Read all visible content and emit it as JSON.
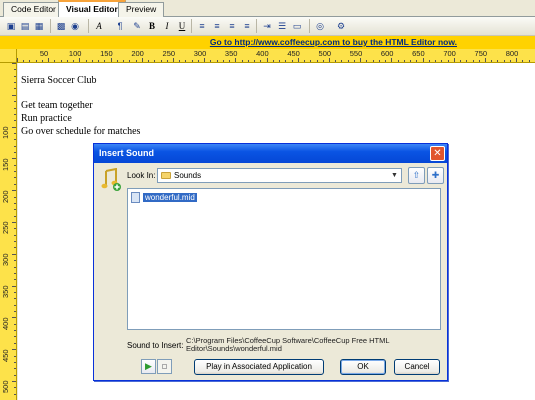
{
  "tabs": [
    {
      "label": "Code Editor"
    },
    {
      "label": "Visual Editor",
      "active": true
    },
    {
      "label": "Preview"
    }
  ],
  "toolbar": {
    "bold": "B",
    "italic": "I",
    "underline": "U",
    "paragraph": "¶",
    "font_color": "A"
  },
  "promo": {
    "text": "Go to http://www.coffeecup.com to buy the HTML Editor now."
  },
  "ruler": {
    "horizontal": [
      "50",
      "100",
      "150",
      "200",
      "250",
      "300",
      "350",
      "400",
      "450",
      "500",
      "550",
      "600",
      "650",
      "700",
      "750",
      "800"
    ],
    "vertical": [
      "100",
      "150",
      "200",
      "250",
      "300",
      "350",
      "400",
      "450",
      "500"
    ]
  },
  "document": {
    "lines": [
      "Sierra Soccer Club",
      "Get team together",
      "Run practice",
      "Go over schedule for matches"
    ]
  },
  "dialog": {
    "title": "Insert Sound",
    "close": "✕",
    "look_in_label": "Look In:",
    "look_in_value": "Sounds",
    "files": [
      "wonderful.mid"
    ],
    "sound_to_insert_label": "Sound to Insert:",
    "sound_to_insert_value": "C:\\Program Files\\CoffeeCup Software\\CoffeeCup Free HTML Editor\\Sounds\\wonderful.mid",
    "play_associated_label": "Play in Associated Application",
    "ok_label": "OK",
    "cancel_label": "Cancel"
  },
  "colors": {
    "promo_bg": "#ffd200",
    "ruler_bg": "#fde24a",
    "title_bar": "#0a54e3",
    "selection": "#316ac5"
  },
  "icons": [
    "save-icon",
    "open-icon",
    "table-icon",
    "image-icon",
    "font-color-icon",
    "paragraph-icon",
    "align-left-icon",
    "align-center-icon",
    "align-right-icon",
    "justify-icon",
    "list-icon",
    "color-icon",
    "music-note-icon",
    "folder-icon",
    "new-folder-icon",
    "play-icon",
    "stop-icon"
  ]
}
